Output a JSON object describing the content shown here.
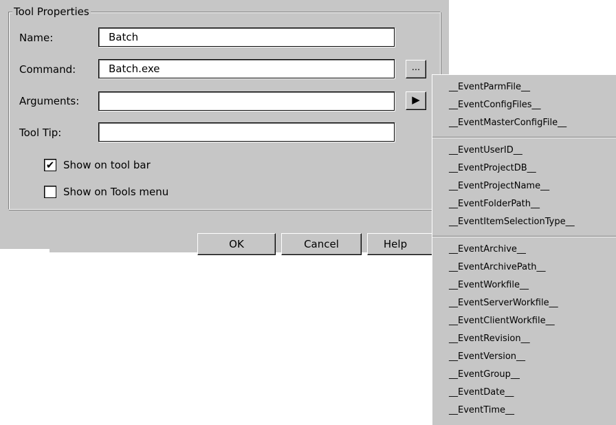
{
  "group": {
    "title": "Tool Properties"
  },
  "fields": {
    "name": {
      "label": "Name:",
      "value": "Batch"
    },
    "command": {
      "label": "Command:",
      "value": "Batch.exe"
    },
    "arguments": {
      "label": "Arguments:",
      "value": ""
    },
    "tooltip": {
      "label": "Tool Tip:",
      "value": ""
    }
  },
  "browse_button": {
    "label": "..."
  },
  "insert_button": {
    "glyph": "▶"
  },
  "checkboxes": {
    "toolbar": {
      "label": "Show on tool bar",
      "checked": true,
      "mark": "✔"
    },
    "tools_menu": {
      "label": "Show on Tools menu",
      "checked": false,
      "mark": ""
    }
  },
  "buttons": {
    "ok": "OK",
    "cancel": "Cancel",
    "help": "Help"
  },
  "menu": {
    "groups": [
      [
        "__EventParmFile__",
        "__EventConfigFiles__",
        "__EventMasterConfigFile__"
      ],
      [
        "__EventUserID__",
        "__EventProjectDB__",
        "__EventProjectName__",
        "__EventFolderPath__",
        "__EventItemSelectionType__"
      ],
      [
        "__EventArchive__",
        "__EventArchivePath__",
        "__EventWorkfile__",
        "__EventServerWorkfile__",
        "__EventClientWorkfile__",
        "__EventRevision__",
        "__EventVersion__",
        "__EventGroup__",
        "__EventDate__",
        "__EventTime__"
      ]
    ]
  }
}
